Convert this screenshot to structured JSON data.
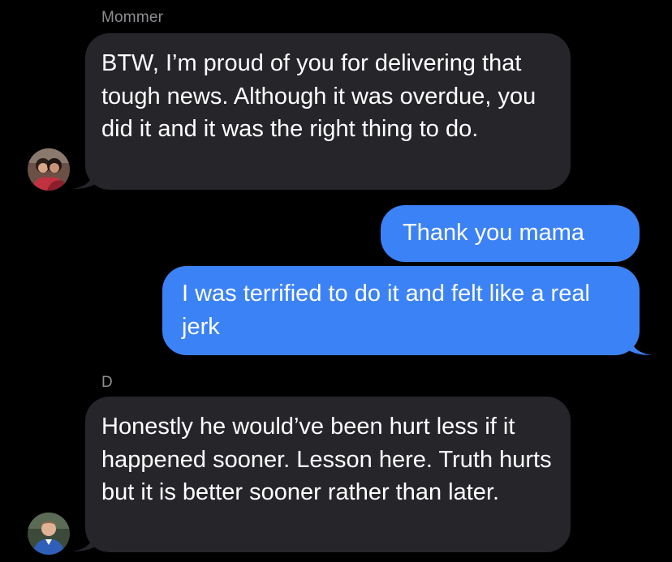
{
  "colors": {
    "background": "#000000",
    "incoming_bubble": "#26252a",
    "outgoing_bubble": "#3b82f6",
    "sender_name": "#8e8e93",
    "text": "#ffffff"
  },
  "messages": [
    {
      "direction": "incoming",
      "sender": "Mommer",
      "avatar": "photo-of-two-women-avatar",
      "text": "BTW, I’m proud of you for delivering that tough news. Although it was overdue, you did it and it was the right thing to do."
    },
    {
      "direction": "outgoing",
      "text": "Thank you mama"
    },
    {
      "direction": "outgoing",
      "text": "I was terrified to do it and felt like a real jerk"
    },
    {
      "direction": "incoming",
      "sender": "D",
      "avatar": "photo-of-man-in-blue-shirt-avatar",
      "text": "Honestly he would’ve been hurt less if it happened sooner. Lesson here. Truth hurts but it is better sooner rather than later."
    }
  ]
}
